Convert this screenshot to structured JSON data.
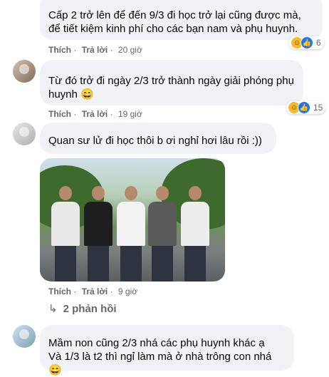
{
  "comments": [
    {
      "name": "",
      "text": "Cấp 2 trở lên để đến 9/3 đi học trở lại cũng được mà, để tiết kiệm kinh phí cho các bạn nam và phụ huynh.",
      "like": "Thích",
      "reply": "Trả lời",
      "time": "20 giờ",
      "reactions": "6"
    },
    {
      "name": "",
      "text": "Từ đó trở đi ngày 2/3 trở thành ngày giải phóng phụ huynh 😄",
      "like": "Thích",
      "reply": "Trả lời",
      "time": "19 giờ",
      "reactions": "15"
    },
    {
      "name": "",
      "text": "Quan sư lử đi học thôi b ơi nghỉ hơi lâu rồi :))",
      "like": "Thích",
      "reply": "Trả lời",
      "time": "9 giờ"
    },
    {
      "name": "",
      "text_line1": "Mầm non cũng 2/3 nhá các phụ huynh khác ạ",
      "text_line2": "Và 1/3 là t2 thì ngỉ làm mà ở nhà trông con nhá 😄"
    }
  ],
  "replies_link": "2 phản hồi",
  "separator": "·",
  "icons": {
    "haha": "haha-icon",
    "like": "like-icon",
    "reply_arrow": "reply-arrow-icon"
  }
}
